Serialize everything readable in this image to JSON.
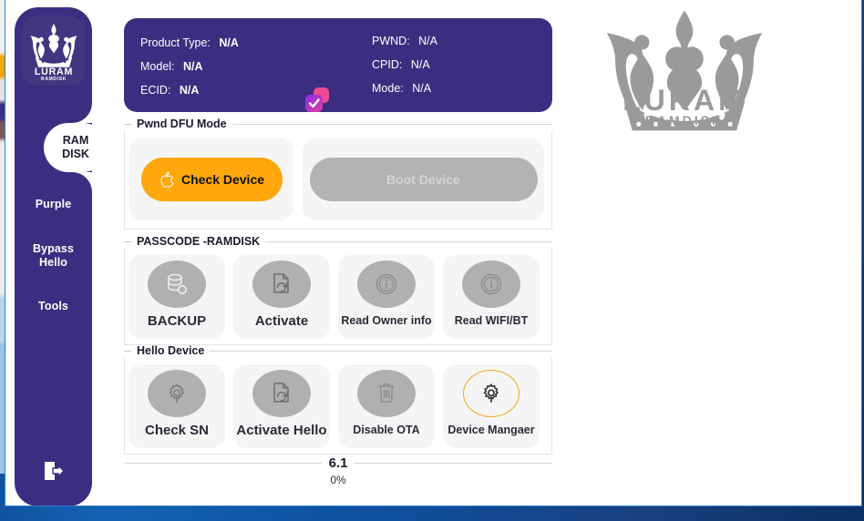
{
  "app": {
    "name": "LURAM RAMDISK",
    "logo_text_main": "LURAM",
    "logo_text_sub": "RAMDISK",
    "accent_purple": "#3b2e80",
    "accent_orange": "#ffa70d",
    "watermark_gray": "#9a9a9a"
  },
  "sidebar": {
    "logo_icon": "crown-icon",
    "active_item": "RAM DISK",
    "items": [
      {
        "id": "ramdisk",
        "label_line1": "RAM",
        "label_line2": "DISK",
        "active": true
      },
      {
        "id": "purple",
        "label_line1": "Purple",
        "label_line2": "",
        "active": false
      },
      {
        "id": "bypass",
        "label_line1": "Bypass",
        "label_line2": "Hello",
        "active": false
      },
      {
        "id": "tools",
        "label_line1": "Tools",
        "label_line2": "",
        "active": false
      }
    ],
    "logout_icon": "logout-icon"
  },
  "info_panel": {
    "badge_icon": "copy-check-icon",
    "left": [
      {
        "label": "Product Type:",
        "value": "N/A"
      },
      {
        "label": "Model:",
        "value": "N/A"
      },
      {
        "label": "ECID:",
        "value": "N/A"
      }
    ],
    "right": [
      {
        "label": "PWND:",
        "value": "N/A"
      },
      {
        "label": "CPID:",
        "value": "N/A"
      },
      {
        "label": "Mode:",
        "value": "N/A"
      }
    ]
  },
  "sections": {
    "pwnd": {
      "title": "Pwnd DFU Mode",
      "check_device_label": "Check Device",
      "check_device_icon": "apple-icon",
      "boot_device_label": "Boot Device",
      "boot_device_enabled": false
    },
    "passcode": {
      "title": "PASSCODE -RAMDISK",
      "tiles": [
        {
          "id": "backup",
          "label": "BACKUP",
          "icon": "database-backup-icon",
          "label_style": "bold-large"
        },
        {
          "id": "activate",
          "label": "Activate",
          "icon": "document-refresh-icon",
          "label_style": "bold-large"
        },
        {
          "id": "read-owner",
          "label": "Read Owner info",
          "icon": "info-circle-icon",
          "label_style": "small"
        },
        {
          "id": "read-wifi",
          "label": "Read WIFI/BT",
          "icon": "info-circle-icon",
          "label_style": "small"
        }
      ]
    },
    "hello": {
      "title": "Hello Device",
      "tiles": [
        {
          "id": "check-sn",
          "label": "Check SN",
          "icon": "gear-icon",
          "label_style": "bold-large",
          "highlighted": false
        },
        {
          "id": "activate-hello",
          "label": "Activate Hello",
          "icon": "document-refresh-icon",
          "label_style": "bold",
          "highlighted": false
        },
        {
          "id": "disable-ota",
          "label": "Disable OTA",
          "icon": "trash-icon",
          "label_style": "small",
          "highlighted": false
        },
        {
          "id": "device-manager",
          "label": "Device Mangaer",
          "icon": "gear-icon",
          "label_style": "small",
          "highlighted": true
        }
      ]
    }
  },
  "footer": {
    "version": "6.1",
    "progress": "0%"
  },
  "watermark": {
    "icon": "crown-icon",
    "text_main": "LURAM",
    "text_sub": "RAMDISK"
  }
}
